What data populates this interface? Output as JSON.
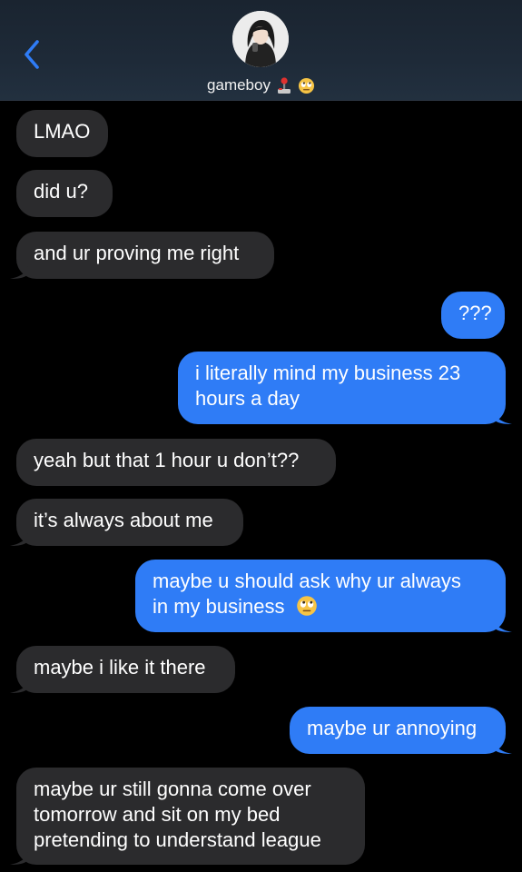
{
  "header": {
    "contact_name": "gameboy",
    "name_emojis": [
      "joystick-emoji",
      "eye-roll-emoji"
    ]
  },
  "messages": [
    {
      "direction": "incoming",
      "lines": [
        "LMAO"
      ]
    },
    {
      "direction": "incoming",
      "lines": [
        "did u?"
      ]
    },
    {
      "direction": "incoming",
      "lines": [
        "and ur proving me right"
      ]
    },
    {
      "direction": "outgoing",
      "lines": [
        "???"
      ]
    },
    {
      "direction": "outgoing",
      "lines": [
        "i literally mind my business 23",
        "hours a day"
      ]
    },
    {
      "direction": "incoming",
      "lines": [
        "yeah but that 1 hour u don’t??"
      ]
    },
    {
      "direction": "incoming",
      "lines": [
        "it’s always about me"
      ]
    },
    {
      "direction": "outgoing",
      "lines": [
        "maybe u should ask why ur always",
        "in my business"
      ],
      "trailing_emoji": "eye-roll-emoji"
    },
    {
      "direction": "incoming",
      "lines": [
        "maybe i like it there"
      ]
    },
    {
      "direction": "outgoing",
      "lines": [
        "maybe ur annoying"
      ]
    },
    {
      "direction": "incoming",
      "lines": [
        "maybe ur still gonna come over",
        "tomorrow and sit on my bed",
        "pretending to understand league"
      ]
    }
  ],
  "colors": {
    "incoming_bubble": "#2b2b2d",
    "outgoing_bubble": "#2f7cf6",
    "accent": "#2f7cf6",
    "background": "#000000"
  }
}
